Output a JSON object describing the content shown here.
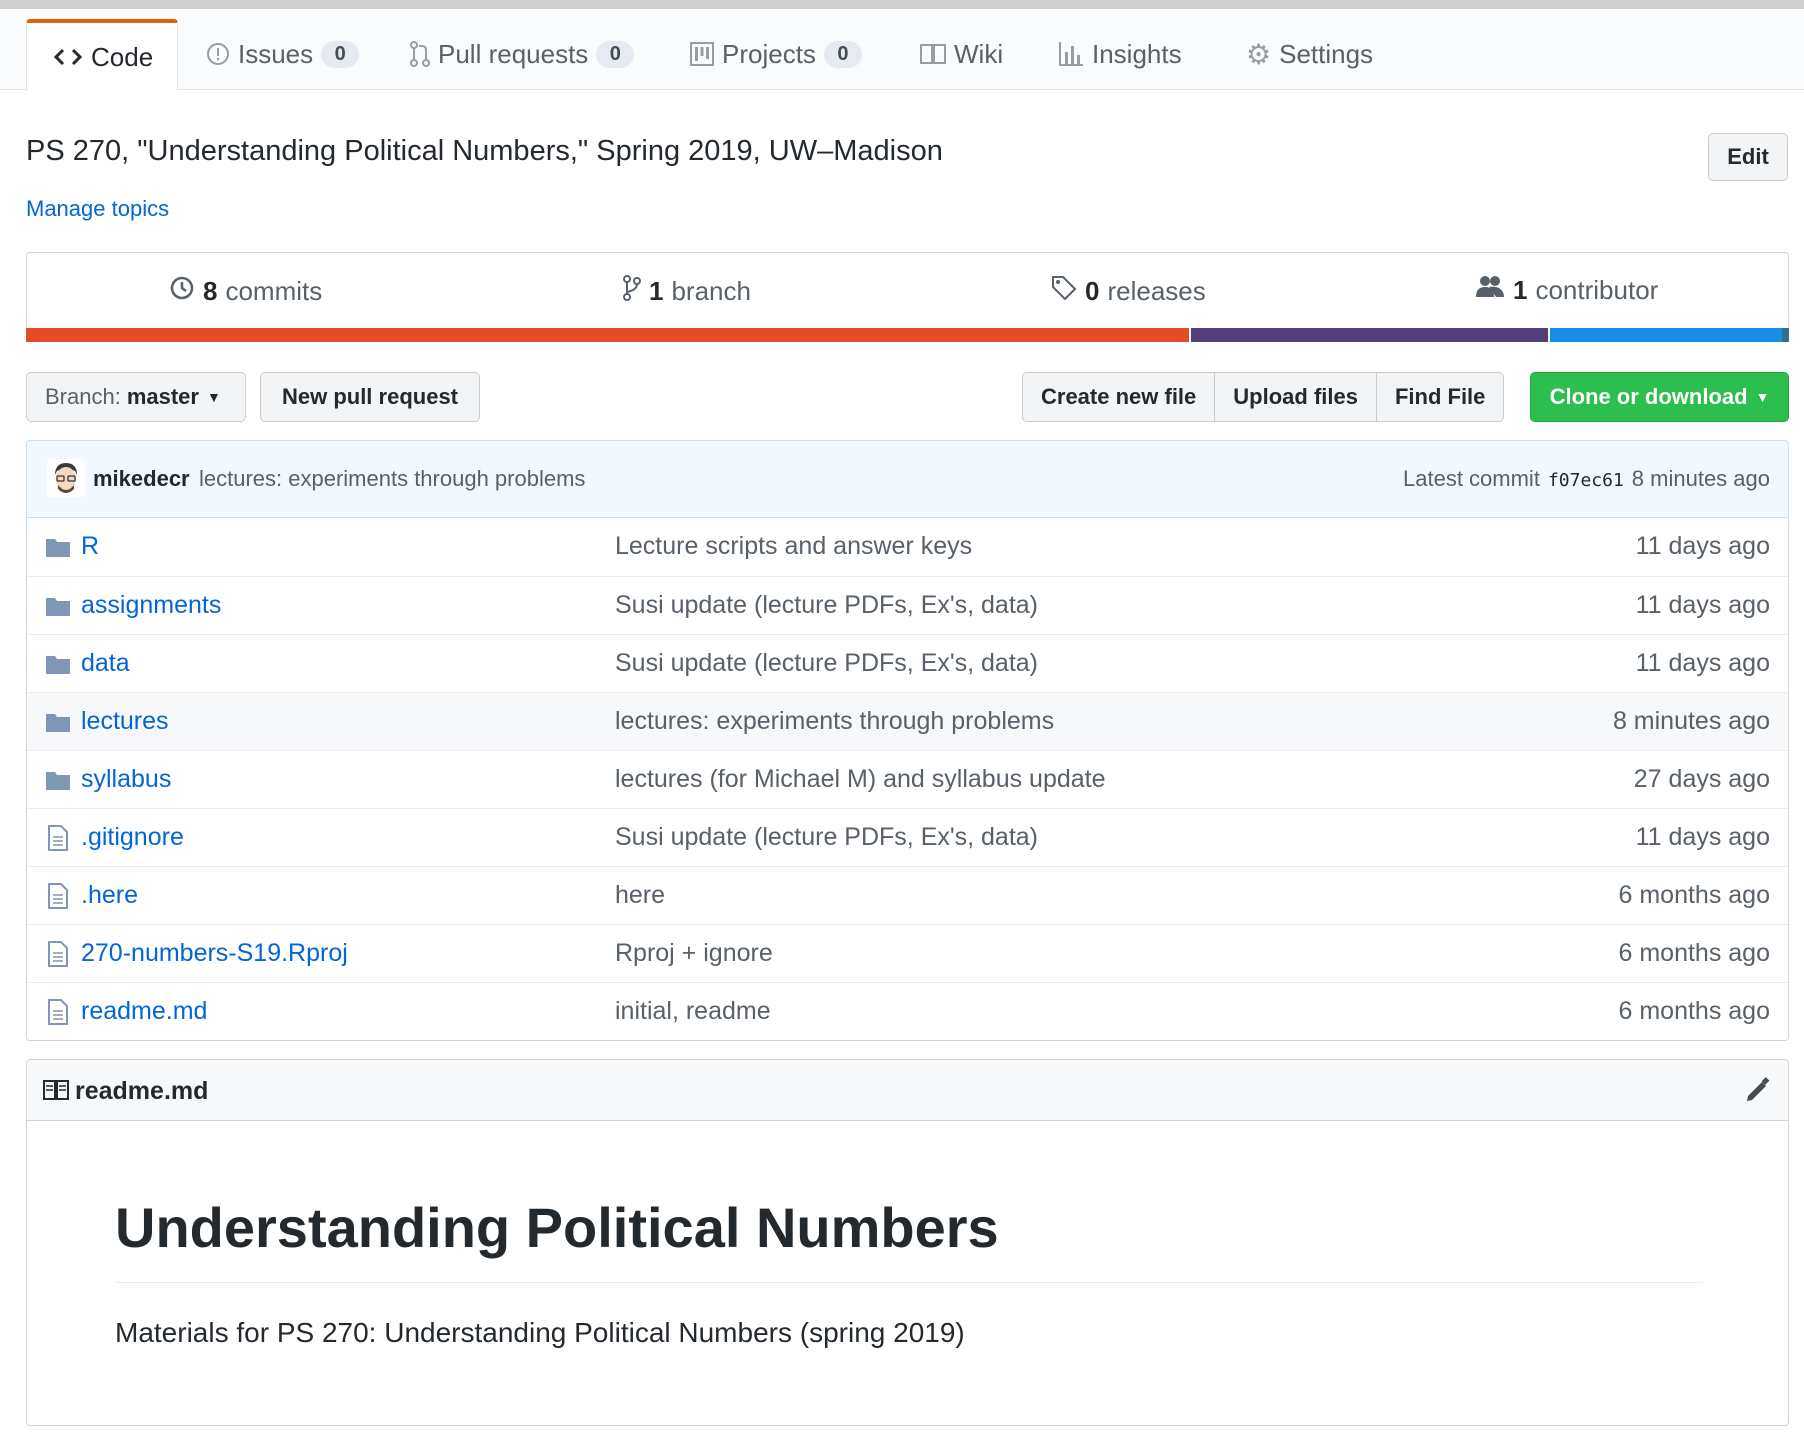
{
  "tabs": [
    {
      "label": "Code",
      "icon": "code-icon"
    },
    {
      "label": "Issues",
      "count": "0",
      "icon": "issue-icon"
    },
    {
      "label": "Pull requests",
      "count": "0",
      "icon": "pull-request-icon"
    },
    {
      "label": "Projects",
      "count": "0",
      "icon": "project-icon"
    },
    {
      "label": "Wiki",
      "icon": "book-icon"
    },
    {
      "label": "Insights",
      "icon": "graph-icon"
    },
    {
      "label": "Settings",
      "icon": "gear-icon"
    }
  ],
  "repo": {
    "description": "PS 270, \"Understanding Political Numbers,\" Spring 2019, UW–Madison",
    "manage_topics": "Manage topics",
    "edit_label": "Edit"
  },
  "summary": {
    "commits_num": "8",
    "commits_label": "commits",
    "branch_num": "1",
    "branch_label": "branch",
    "releases_num": "0",
    "releases_label": "releases",
    "contributor_num": "1",
    "contributor_label": "contributor"
  },
  "languages_colors": [
    "#e34c26",
    "#563d7c",
    "#198ce7",
    "#2b7489"
  ],
  "toolbar": {
    "branch_prefix": "Branch:",
    "branch_name": "master",
    "new_pull_request": "New pull request",
    "create_new_file": "Create new file",
    "upload_files": "Upload files",
    "find_file": "Find File",
    "clone_or_download": "Clone or download"
  },
  "commit": {
    "author": "mikedecr",
    "message": "lectures: experiments through problems",
    "latest_label": "Latest commit",
    "sha": "f07ec61",
    "age": "8 minutes ago"
  },
  "files": [
    {
      "name": "R",
      "type": "folder",
      "message": "Lecture scripts and answer keys",
      "age": "11 days ago"
    },
    {
      "name": "assignments",
      "type": "folder",
      "message": "Susi update (lecture PDFs, Ex's, data)",
      "age": "11 days ago"
    },
    {
      "name": "data",
      "type": "folder",
      "message": "Susi update (lecture PDFs, Ex's, data)",
      "age": "11 days ago"
    },
    {
      "name": "lectures",
      "type": "folder",
      "message": "lectures: experiments through problems",
      "age": "8 minutes ago"
    },
    {
      "name": "syllabus",
      "type": "folder",
      "message": "lectures (for Michael M) and syllabus update",
      "age": "27 days ago"
    },
    {
      "name": ".gitignore",
      "type": "file",
      "message": "Susi update (lecture PDFs, Ex's, data)",
      "age": "11 days ago"
    },
    {
      "name": ".here",
      "type": "file",
      "message": "here",
      "age": "6 months ago"
    },
    {
      "name": "270-numbers-S19.Rproj",
      "type": "file",
      "message": "Rproj + ignore",
      "age": "6 months ago"
    },
    {
      "name": "readme.md",
      "type": "file",
      "message": "initial, readme",
      "age": "6 months ago"
    }
  ],
  "readme": {
    "filename": "readme.md",
    "heading": "Understanding Political Numbers",
    "paragraph": "Materials for PS 270: Understanding Political Numbers (spring 2019)"
  }
}
